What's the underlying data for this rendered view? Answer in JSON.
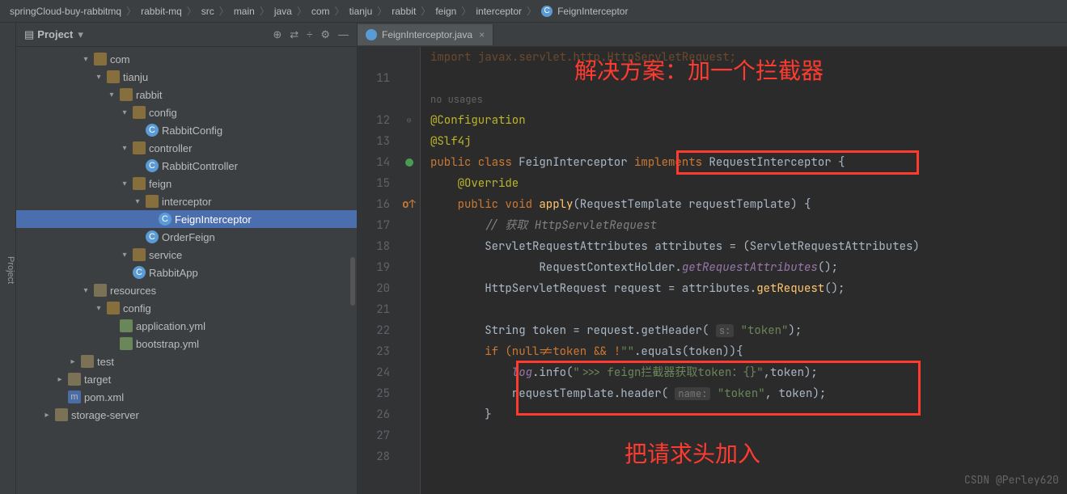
{
  "breadcrumb": [
    "springCloud-buy-rabbitmq",
    "rabbit-mq",
    "src",
    "main",
    "java",
    "com",
    "tianju",
    "rabbit",
    "feign",
    "interceptor",
    "FeignInterceptor"
  ],
  "sidebar": {
    "title": "Project",
    "side_label": "Project",
    "tree": [
      {
        "indent": 5,
        "chev": "▾",
        "icon": "folder-open",
        "label": "com"
      },
      {
        "indent": 6,
        "chev": "▾",
        "icon": "folder-open",
        "label": "tianju"
      },
      {
        "indent": 7,
        "chev": "▾",
        "icon": "folder-open",
        "label": "rabbit"
      },
      {
        "indent": 8,
        "chev": "▾",
        "icon": "folder-open",
        "label": "config"
      },
      {
        "indent": 9,
        "chev": "",
        "icon": "class",
        "label": "RabbitConfig"
      },
      {
        "indent": 8,
        "chev": "▾",
        "icon": "folder-open",
        "label": "controller"
      },
      {
        "indent": 9,
        "chev": "",
        "icon": "class",
        "label": "RabbitController"
      },
      {
        "indent": 8,
        "chev": "▾",
        "icon": "folder-open",
        "label": "feign"
      },
      {
        "indent": 9,
        "chev": "▾",
        "icon": "folder-open",
        "label": "interceptor"
      },
      {
        "indent": 10,
        "chev": "",
        "icon": "class",
        "label": "FeignInterceptor",
        "selected": true
      },
      {
        "indent": 9,
        "chev": "",
        "icon": "class",
        "label": "OrderFeign"
      },
      {
        "indent": 8,
        "chev": "▾",
        "icon": "folder-open",
        "label": "service"
      },
      {
        "indent": 8,
        "chev": "",
        "icon": "class",
        "label": "RabbitApp"
      },
      {
        "indent": 5,
        "chev": "▾",
        "icon": "folder",
        "label": "resources"
      },
      {
        "indent": 6,
        "chev": "▾",
        "icon": "folder-open",
        "label": "config"
      },
      {
        "indent": 7,
        "chev": "",
        "icon": "yml",
        "label": "application.yml"
      },
      {
        "indent": 7,
        "chev": "",
        "icon": "yml",
        "label": "bootstrap.yml"
      },
      {
        "indent": 4,
        "chev": "▸",
        "icon": "folder",
        "label": "test"
      },
      {
        "indent": 3,
        "chev": "▸",
        "icon": "folder",
        "label": "target"
      },
      {
        "indent": 3,
        "chev": "",
        "icon": "module",
        "label": "pom.xml"
      },
      {
        "indent": 2,
        "chev": "▸",
        "icon": "folder",
        "label": "storage-server"
      }
    ]
  },
  "tabs": [
    {
      "label": "FeignInterceptor.java"
    }
  ],
  "gutter_start": 11,
  "gutter_lines": [
    "",
    "11",
    "",
    "12",
    "13",
    "14",
    "15",
    "16",
    "17",
    "18",
    "19",
    "20",
    "21",
    "22",
    "23",
    "24",
    "25",
    "26",
    "27",
    "28"
  ],
  "gutter_marks": [
    "",
    "",
    "",
    "fold",
    "",
    "green",
    "",
    "orange",
    "",
    "",
    "",
    "",
    "",
    "",
    "",
    "",
    "",
    "",
    "",
    ""
  ],
  "code": {
    "line_top": "import javax.servlet.http.HttpServletRequest;",
    "no_usage": "no usages",
    "l12": "@Configuration",
    "l13": "@Slf4j",
    "l14_a": "public class ",
    "l14_b": "FeignInterceptor ",
    "l14_c": "implements ",
    "l14_d": "RequestInterceptor ",
    "l14_e": "{",
    "l15": "    @Override",
    "l16_a": "    public void ",
    "l16_b": "apply",
    "l16_c": "(RequestTemplate requestTemplate) {",
    "l17": "        // 获取 HttpServletRequest",
    "l18": "        ServletRequestAttributes attributes = (ServletRequestAttributes)",
    "l19_a": "                RequestContextHolder.",
    "l19_b": "getRequestAttributes",
    "l19_c": "();",
    "l20_a": "        HttpServletRequest request = attributes.",
    "l20_b": "getRequest",
    "l20_c": "();",
    "l22_a": "        String token = request.getHeader( ",
    "l22_hint": "s:",
    "l22_b": "\"token\"",
    "l22_c": ");",
    "l23_a": "        if (null!=token && !",
    "l23_b": "\"\"",
    "l23_c": ".equals(token)){",
    "l24_a": "            ",
    "l24_b": "log",
    "l24_c": ".info(",
    "l24_d": "\">>> feign拦截器获取token：{}\"",
    "l24_e": ",token);",
    "l25_a": "            requestTemplate.header( ",
    "l25_hint": "name:",
    "l25_b": "\"token\"",
    "l25_c": ", token);",
    "l26": "        }"
  },
  "annotations": {
    "a1": "解决方案：加一个拦截器",
    "a2": "把请求头加入"
  },
  "watermark": "CSDN @Perley620"
}
